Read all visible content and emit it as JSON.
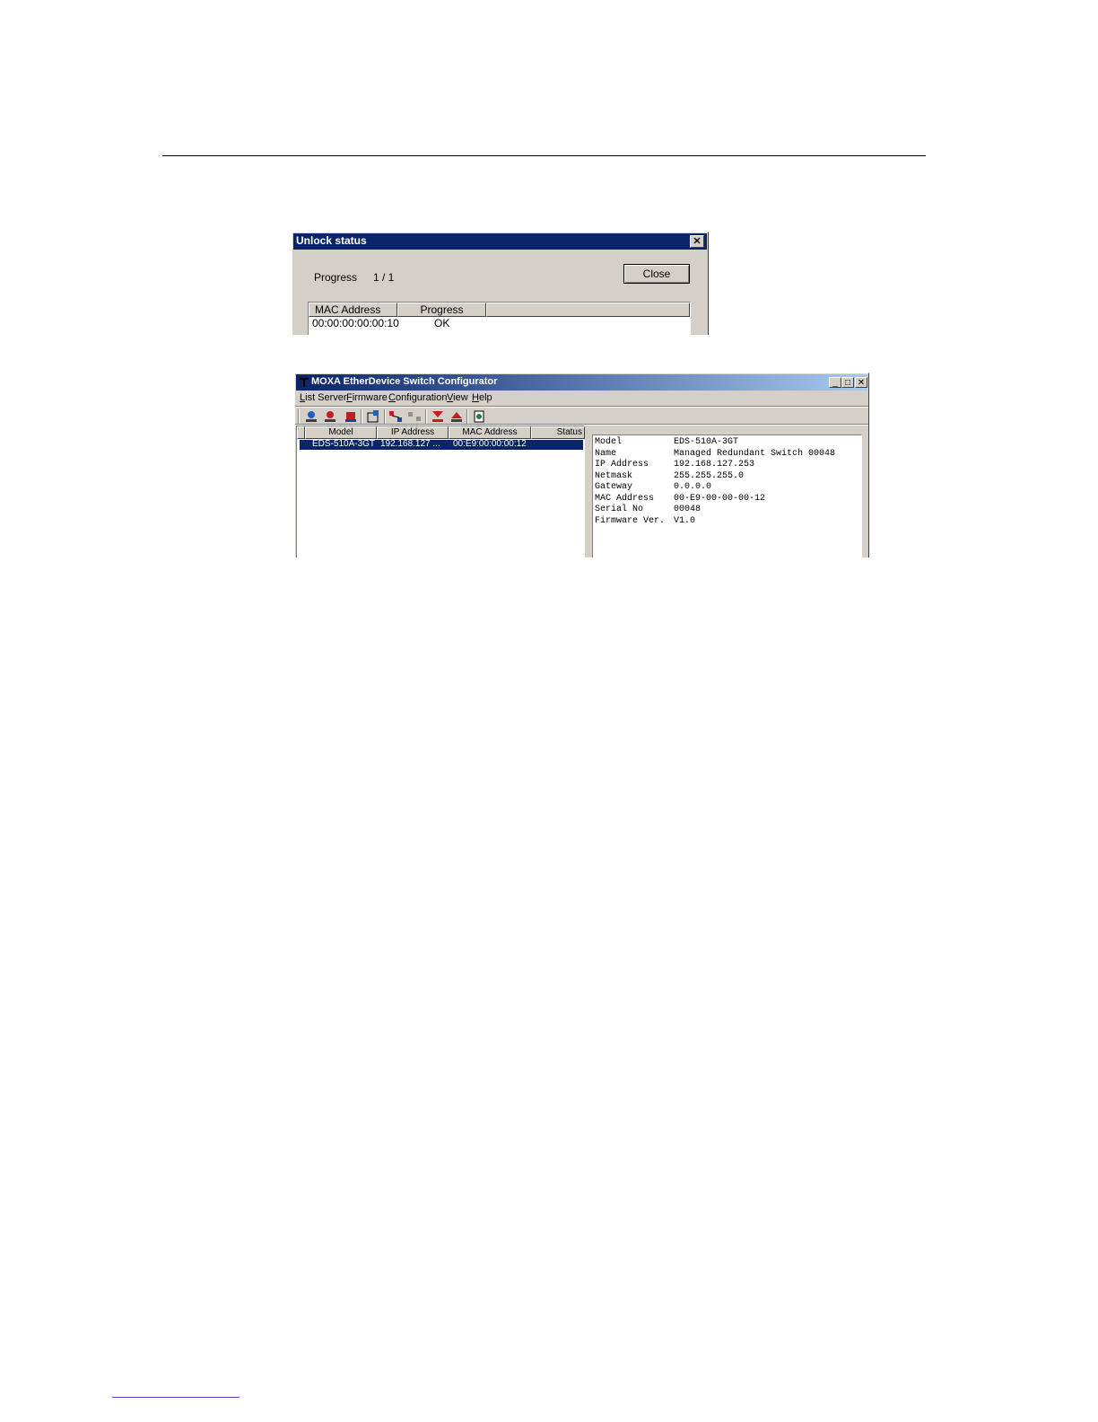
{
  "unlock_dialog": {
    "title": "Unlock status",
    "progress_label": "Progress",
    "progress_value": "1 / 1",
    "close_label": "Close",
    "columns": [
      "MAC Address",
      "Progress"
    ],
    "rows": [
      {
        "mac": "00:00:00:00:00:10",
        "progress": "OK"
      }
    ]
  },
  "configurator": {
    "title": "MOXA EtherDevice Switch Configurator",
    "menu": [
      "List Server",
      "Firmware",
      "Configuration",
      "View",
      "Help"
    ],
    "menu_accel": [
      "L",
      "F",
      "C",
      "V",
      "H"
    ],
    "menu_rest": [
      "ist Server",
      "irmware",
      "onfiguration",
      "iew",
      "elp"
    ],
    "toolbar_icons": [
      "locate-server-icon",
      "unlock-icon",
      "lock-icon",
      "settings-icon",
      "connect-icon",
      "disconnect-icon",
      "upgrade-firmware-icon",
      "upload-icon",
      "export-icon"
    ],
    "columns": [
      "Model",
      "IP Address",
      "MAC Address",
      "Status"
    ],
    "devices": [
      {
        "model": "EDS-510A-3GT",
        "ip": "192.168.127 ...",
        "mac": "00:E9:00:00:00:12",
        "status": ""
      }
    ],
    "details": [
      {
        "key": "Model",
        "value": "EDS-510A-3GT"
      },
      {
        "key": "Name",
        "value": "Managed Redundant Switch 00048"
      },
      {
        "key": "IP Address",
        "value": "192.168.127.253"
      },
      {
        "key": "Netmask",
        "value": "255.255.255.0"
      },
      {
        "key": "Gateway",
        "value": "0.0.0.0"
      },
      {
        "key": "MAC Address",
        "value": "00-E9-00-00-00-12"
      },
      {
        "key": "Serial No",
        "value": "00048"
      },
      {
        "key": "Firmware Ver.",
        "value": "V1.0"
      }
    ],
    "colors": {
      "selection": "#0a246a",
      "face": "#d4d0c8"
    }
  }
}
